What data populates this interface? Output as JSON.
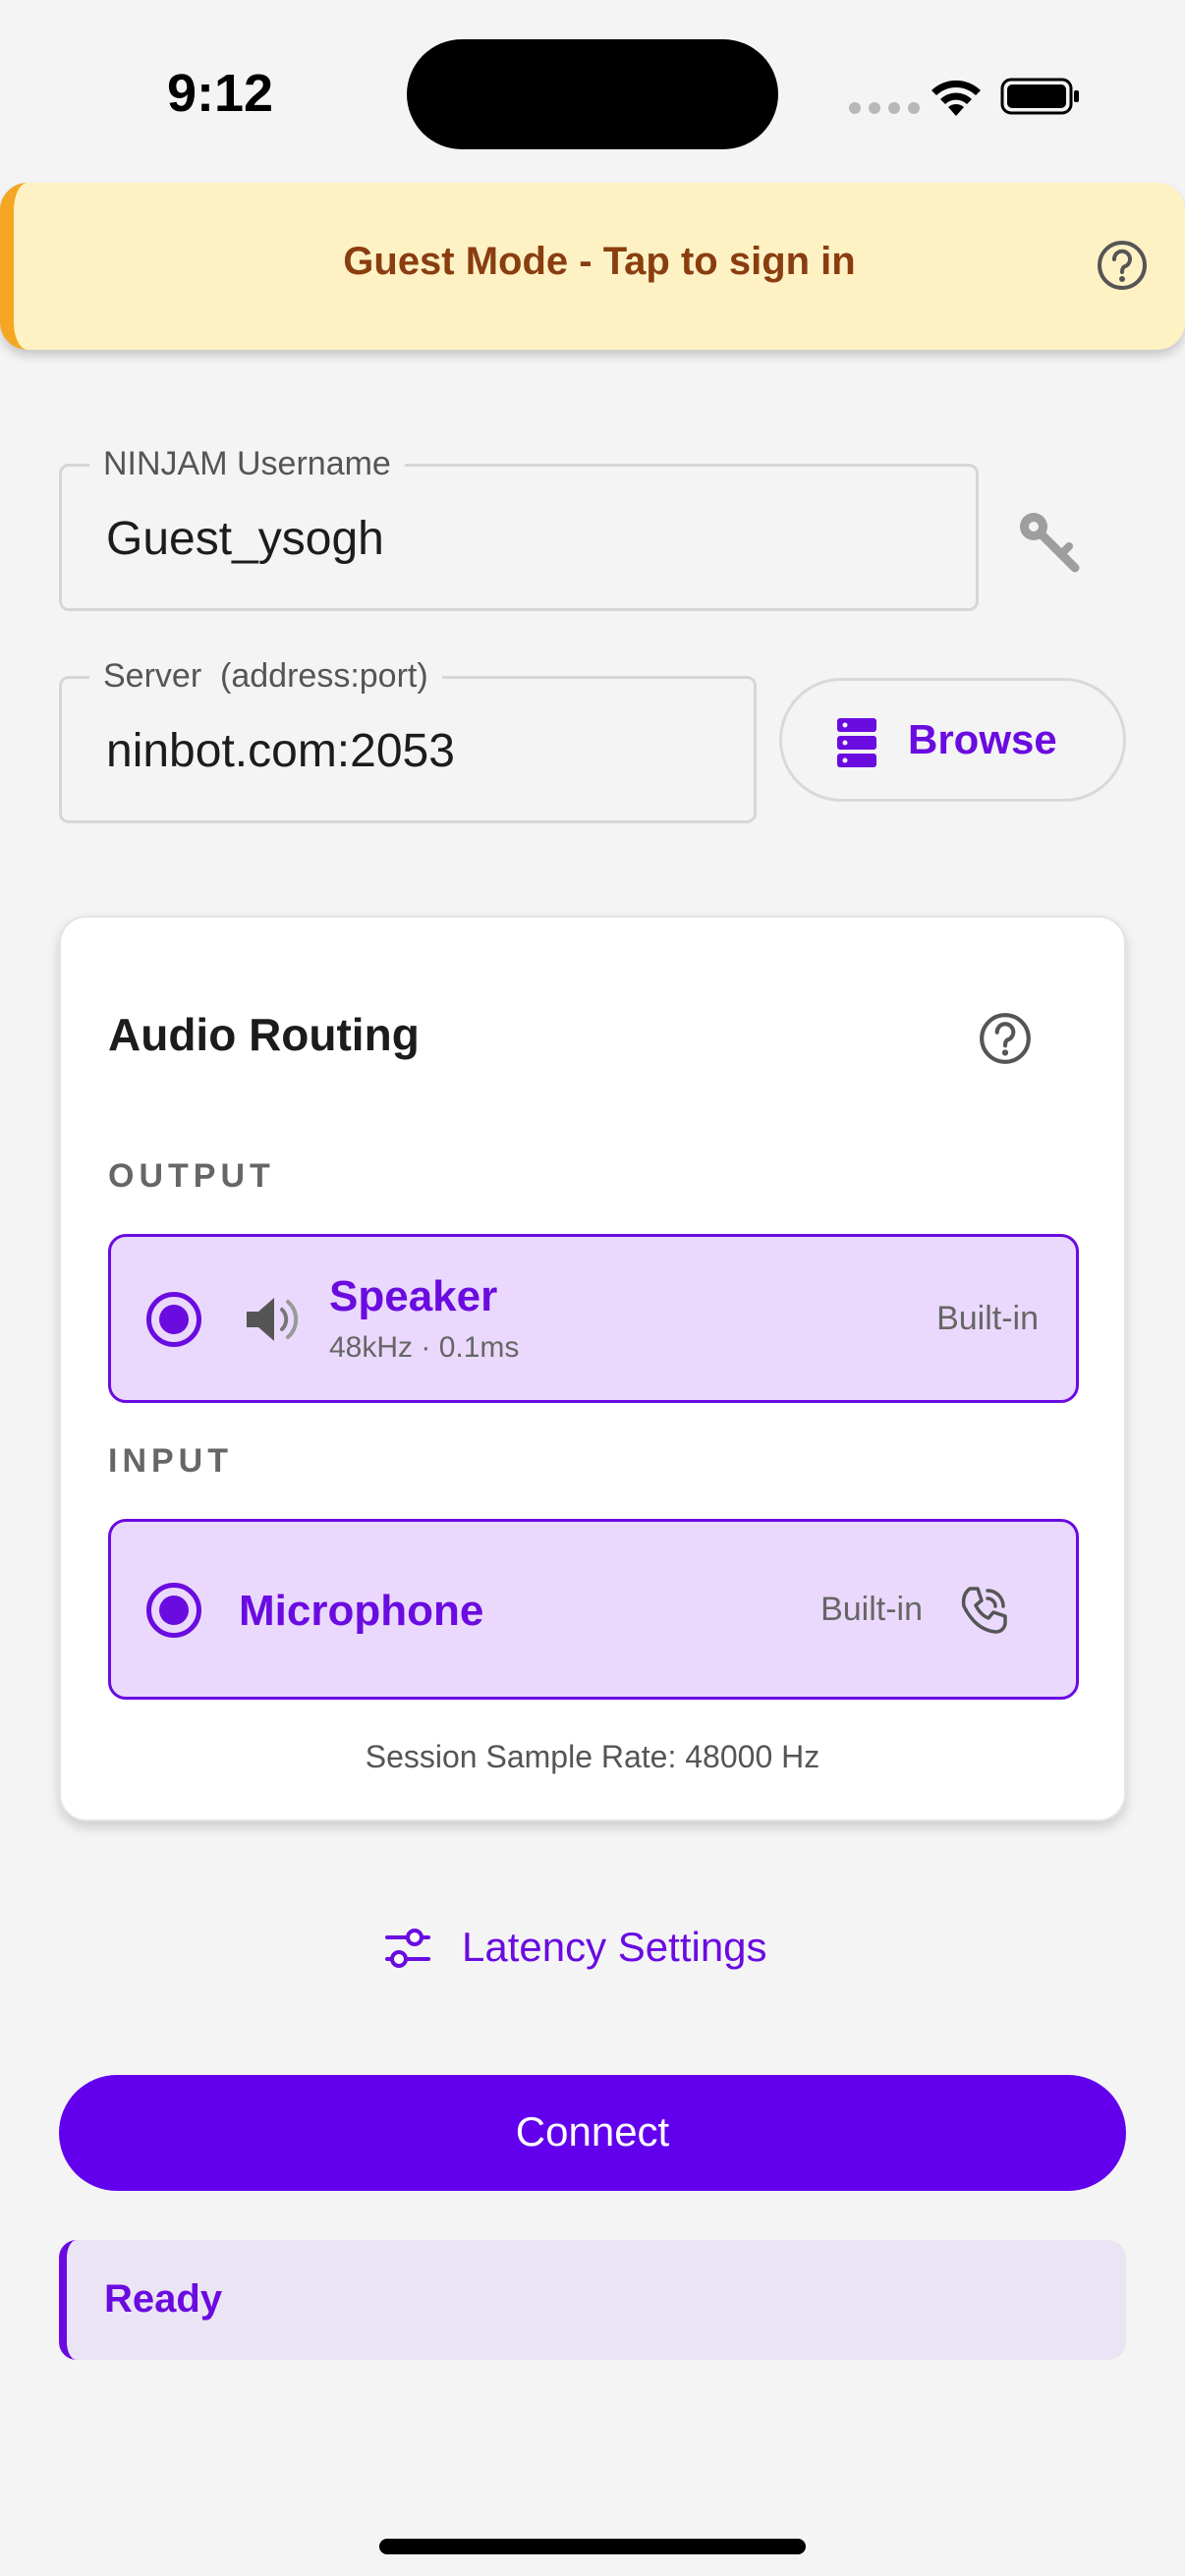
{
  "status_bar": {
    "time": "9:12"
  },
  "banner": {
    "text": "Guest Mode - Tap to sign in",
    "accent_color": "#f5a623",
    "background_color": "#fef2c4",
    "help_icon": "help-circle-icon"
  },
  "username": {
    "label": "NINJAM Username",
    "value": "Guest_ysogh",
    "icon": "key-icon"
  },
  "server": {
    "label": "Server  (address:port)",
    "value": "ninbot.com:2053"
  },
  "browse": {
    "label": "Browse",
    "icon": "server-list-icon"
  },
  "audio_routing": {
    "title": "Audio Routing",
    "help_icon": "help-circle-icon",
    "output": {
      "section_label": "OUTPUT",
      "device_name": "Speaker",
      "device_detail": "48kHz · 0.1ms",
      "tag": "Built-in",
      "icon": "speaker-icon",
      "selected": true
    },
    "input": {
      "section_label": "INPUT",
      "device_name": "Microphone",
      "tag": "Built-in",
      "icon": "phone-icon",
      "selected": true
    },
    "sample_rate_text": "Session Sample Rate: 48000 Hz"
  },
  "latency": {
    "label": "Latency Settings",
    "icon": "sliders-icon"
  },
  "connect": {
    "label": "Connect",
    "color": "#6200ee"
  },
  "status": {
    "text": "Ready"
  },
  "accent_color": "#6a0be0"
}
